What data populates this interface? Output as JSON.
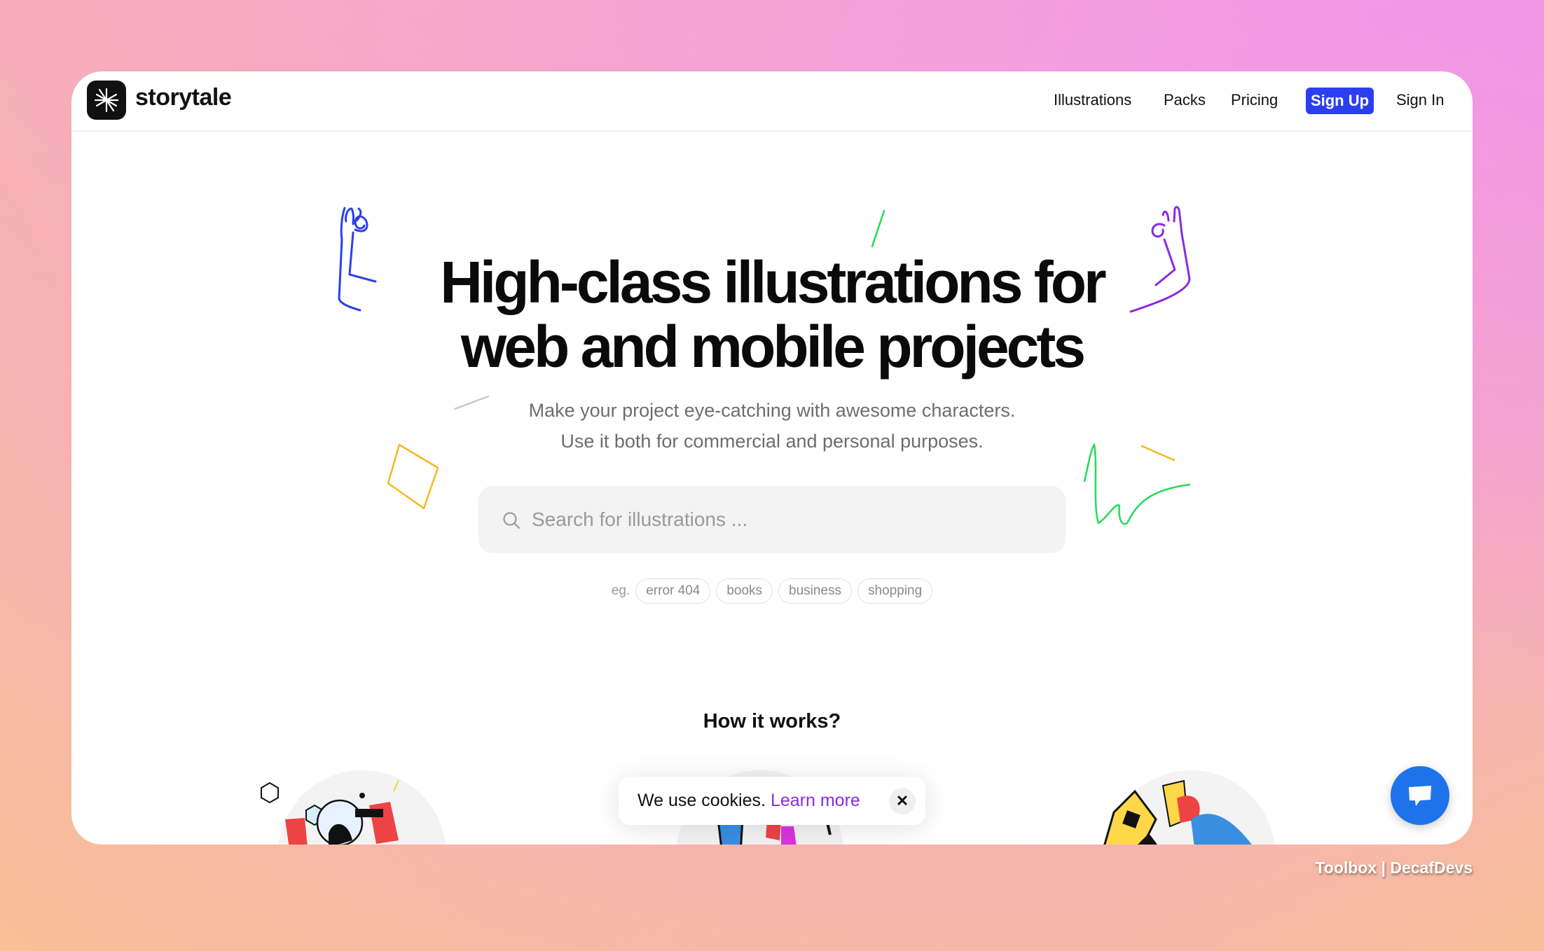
{
  "header": {
    "brand": "storytale",
    "nav": [
      "Illustrations",
      "Packs",
      "Pricing"
    ],
    "signup": "Sign Up",
    "signin": "Sign In"
  },
  "hero": {
    "title_line1": "High-class illustrations for",
    "title_line2": "web and mobile projects",
    "subtitle_line1": "Make your project eye-catching with awesome characters.",
    "subtitle_line2": "Use it both for commercial and personal purposes."
  },
  "search": {
    "placeholder": "Search for illustrations ...",
    "value": ""
  },
  "tags": {
    "prefix": "eg.",
    "items": [
      "error 404",
      "books",
      "business",
      "shopping"
    ]
  },
  "how": {
    "title": "How it works?"
  },
  "cookie": {
    "text": "We use cookies.",
    "link": "Learn more",
    "close": "✕"
  },
  "watermark": "Toolbox | DecafDevs",
  "colors": {
    "accent": "#2b3ff0",
    "link": "#8a2be2",
    "chat": "#1f73ea"
  }
}
